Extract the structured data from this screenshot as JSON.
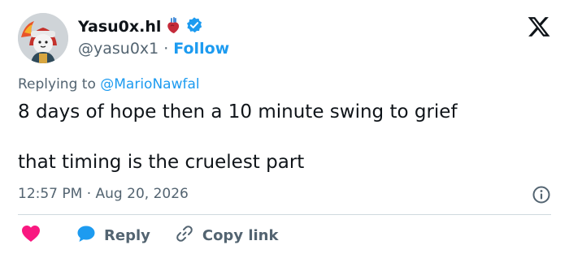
{
  "author": {
    "display_name": "Yasu0x.hl",
    "emoji_icon": "anatomical-heart-icon",
    "verified_icon": "verified-badge-icon",
    "handle": "@yasu0x1",
    "separator": "·",
    "follow_label": "Follow"
  },
  "reply_context": {
    "prefix": "Replying to ",
    "target": "@MarioNawfal"
  },
  "tweet": {
    "line1": "8 days of hope then a 10 minute swing to grief",
    "line2": "that timing is the cruelest part",
    "timestamp": "12:57 PM · Aug 20, 2026"
  },
  "actions": {
    "reply_label": "Reply",
    "copy_link_label": "Copy link"
  },
  "colors": {
    "accent": "#1d9bf0",
    "like": "#f91880",
    "muted": "#536471",
    "text": "#0f1419"
  }
}
